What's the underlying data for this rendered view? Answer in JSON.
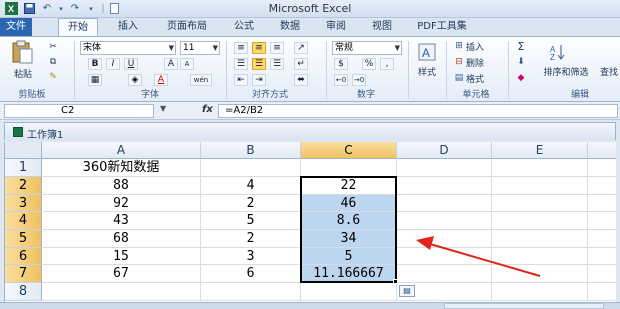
{
  "app": {
    "title": "Microsoft Excel"
  },
  "quick_access": {
    "save_icon": "save-icon",
    "undo_icon": "undo-icon",
    "redo_icon": "redo-icon"
  },
  "ribbon_tabs": [
    {
      "label": "文件",
      "state": "file"
    },
    {
      "label": "开始",
      "state": "active"
    },
    {
      "label": "插入",
      "state": ""
    },
    {
      "label": "页面布局",
      "state": ""
    },
    {
      "label": "公式",
      "state": ""
    },
    {
      "label": "数据",
      "state": ""
    },
    {
      "label": "审阅",
      "state": ""
    },
    {
      "label": "视图",
      "state": ""
    },
    {
      "label": "PDF工具集",
      "state": ""
    }
  ],
  "ribbon": {
    "clipboard": {
      "paste_label": "粘贴",
      "group_label": "剪贴板"
    },
    "font": {
      "font_name": "宋体",
      "font_size": "11",
      "group_label": "字体",
      "bold": "B",
      "italic": "I",
      "underline": "U",
      "grow": "A",
      "shrink": "A",
      "font_color_letter": "A",
      "phonetic": "wén"
    },
    "alignment": {
      "group_label": "对齐方式"
    },
    "number": {
      "format": "常规",
      "percent": "%",
      "comma": ",",
      "group_label": "数字"
    },
    "styles": {
      "label": "样式"
    },
    "cells": {
      "insert": "插入",
      "delete": "删除",
      "format": "格式",
      "group_label": "单元格"
    },
    "editing": {
      "sigma": "Σ",
      "sort_filter": "排序和筛选",
      "find": "查找",
      "group_label": "编辑"
    }
  },
  "formula_bar": {
    "name_box": "C2",
    "fx": "fx",
    "formula": "=A2/B2"
  },
  "workbook": {
    "title": "工作簿1"
  },
  "columns": [
    "A",
    "B",
    "C",
    "D",
    "E"
  ],
  "rows": [
    "1",
    "2",
    "3",
    "4",
    "5",
    "6",
    "7",
    "8"
  ],
  "cells": [
    [
      "360新知数据",
      "",
      "",
      "",
      ""
    ],
    [
      "88",
      "4",
      "22",
      "",
      ""
    ],
    [
      "92",
      "2",
      "46",
      "",
      ""
    ],
    [
      "43",
      "5",
      "8.6",
      "",
      ""
    ],
    [
      "68",
      "2",
      "34",
      "",
      ""
    ],
    [
      "15",
      "3",
      "5",
      "",
      ""
    ],
    [
      "67",
      "6",
      "11.166667",
      "",
      ""
    ],
    [
      "",
      "",
      "",
      "",
      ""
    ]
  ],
  "selection": {
    "active_cell": "C2",
    "range": "C2:C7"
  },
  "annotation": {
    "arrow_color": "#e0241b"
  }
}
